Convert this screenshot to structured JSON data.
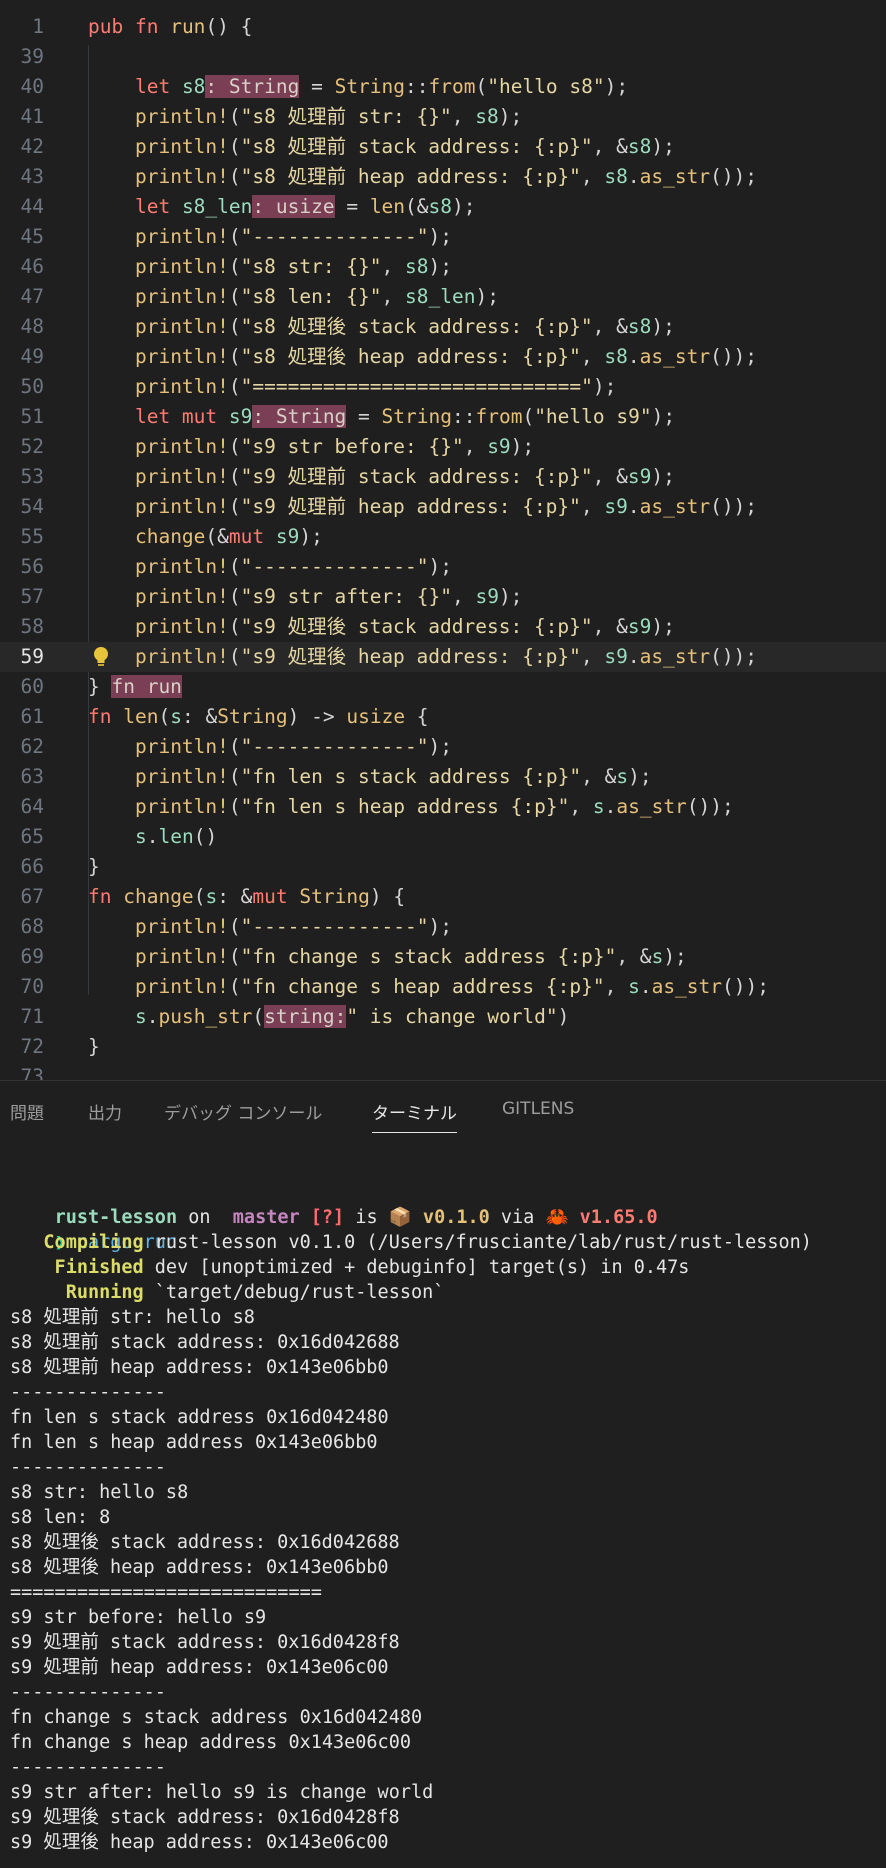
{
  "editor": {
    "active_line": "59",
    "lines": [
      {
        "n": "1",
        "tokens": [
          [
            "kw",
            "pub "
          ],
          [
            "kw",
            "fn "
          ],
          [
            "fnn",
            "run"
          ],
          [
            "punc",
            "() {"
          ]
        ]
      },
      {
        "n": "39",
        "tokens": []
      },
      {
        "n": "40",
        "tokens": [
          [
            "plain",
            "    "
          ],
          [
            "kw",
            "let "
          ],
          [
            "var",
            "s8"
          ],
          [
            "hint",
            ": String"
          ],
          [
            "punc",
            " = "
          ],
          [
            "fnn",
            "String"
          ],
          [
            "punc",
            "::"
          ],
          [
            "fnn",
            "from"
          ],
          [
            "punc",
            "("
          ],
          [
            "str",
            "\"hello s8\""
          ],
          [
            "punc",
            ");"
          ]
        ]
      },
      {
        "n": "41",
        "tokens": [
          [
            "plain",
            "    "
          ],
          [
            "mac",
            "println!"
          ],
          [
            "punc",
            "("
          ],
          [
            "str",
            "\"s8 処理前 str: {}\""
          ],
          [
            "punc",
            ", "
          ],
          [
            "var",
            "s8"
          ],
          [
            "punc",
            ");"
          ]
        ]
      },
      {
        "n": "42",
        "tokens": [
          [
            "plain",
            "    "
          ],
          [
            "mac",
            "println!"
          ],
          [
            "punc",
            "("
          ],
          [
            "str",
            "\"s8 処理前 stack address: {:p}\""
          ],
          [
            "punc",
            ", &"
          ],
          [
            "var",
            "s8"
          ],
          [
            "punc",
            ");"
          ]
        ]
      },
      {
        "n": "43",
        "tokens": [
          [
            "plain",
            "    "
          ],
          [
            "mac",
            "println!"
          ],
          [
            "punc",
            "("
          ],
          [
            "str",
            "\"s8 処理前 heap address: {:p}\""
          ],
          [
            "punc",
            ", "
          ],
          [
            "var",
            "s8"
          ],
          [
            "punc",
            "."
          ],
          [
            "fnn",
            "as_str"
          ],
          [
            "punc",
            "());"
          ]
        ]
      },
      {
        "n": "44",
        "tokens": [
          [
            "plain",
            "    "
          ],
          [
            "kw",
            "let "
          ],
          [
            "var",
            "s8_len"
          ],
          [
            "hint",
            ": usize"
          ],
          [
            "punc",
            " = "
          ],
          [
            "fnn",
            "len"
          ],
          [
            "punc",
            "(&"
          ],
          [
            "var",
            "s8"
          ],
          [
            "punc",
            ");"
          ]
        ]
      },
      {
        "n": "45",
        "tokens": [
          [
            "plain",
            "    "
          ],
          [
            "mac",
            "println!"
          ],
          [
            "punc",
            "("
          ],
          [
            "str",
            "\"--------------\""
          ],
          [
            "punc",
            ");"
          ]
        ]
      },
      {
        "n": "46",
        "tokens": [
          [
            "plain",
            "    "
          ],
          [
            "mac",
            "println!"
          ],
          [
            "punc",
            "("
          ],
          [
            "str",
            "\"s8 str: {}\""
          ],
          [
            "punc",
            ", "
          ],
          [
            "var",
            "s8"
          ],
          [
            "punc",
            ");"
          ]
        ]
      },
      {
        "n": "47",
        "tokens": [
          [
            "plain",
            "    "
          ],
          [
            "mac",
            "println!"
          ],
          [
            "punc",
            "("
          ],
          [
            "str",
            "\"s8 len: {}\""
          ],
          [
            "punc",
            ", "
          ],
          [
            "var",
            "s8_len"
          ],
          [
            "punc",
            ");"
          ]
        ]
      },
      {
        "n": "48",
        "tokens": [
          [
            "plain",
            "    "
          ],
          [
            "mac",
            "println!"
          ],
          [
            "punc",
            "("
          ],
          [
            "str",
            "\"s8 処理後 stack address: {:p}\""
          ],
          [
            "punc",
            ", &"
          ],
          [
            "var",
            "s8"
          ],
          [
            "punc",
            ");"
          ]
        ]
      },
      {
        "n": "49",
        "tokens": [
          [
            "plain",
            "    "
          ],
          [
            "mac",
            "println!"
          ],
          [
            "punc",
            "("
          ],
          [
            "str",
            "\"s8 処理後 heap address: {:p}\""
          ],
          [
            "punc",
            ", "
          ],
          [
            "var",
            "s8"
          ],
          [
            "punc",
            "."
          ],
          [
            "fnn",
            "as_str"
          ],
          [
            "punc",
            "());"
          ]
        ]
      },
      {
        "n": "50",
        "tokens": [
          [
            "plain",
            "    "
          ],
          [
            "mac",
            "println!"
          ],
          [
            "punc",
            "("
          ],
          [
            "str",
            "\"============================\""
          ],
          [
            "punc",
            ");"
          ]
        ]
      },
      {
        "n": "51",
        "tokens": [
          [
            "plain",
            "    "
          ],
          [
            "kw",
            "let mut "
          ],
          [
            "var",
            "s9"
          ],
          [
            "hint",
            ": String"
          ],
          [
            "punc",
            " = "
          ],
          [
            "fnn",
            "String"
          ],
          [
            "punc",
            "::"
          ],
          [
            "fnn",
            "from"
          ],
          [
            "punc",
            "("
          ],
          [
            "str",
            "\"hello s9\""
          ],
          [
            "punc",
            ");"
          ]
        ]
      },
      {
        "n": "52",
        "tokens": [
          [
            "plain",
            "    "
          ],
          [
            "mac",
            "println!"
          ],
          [
            "punc",
            "("
          ],
          [
            "str",
            "\"s9 str before: {}\""
          ],
          [
            "punc",
            ", "
          ],
          [
            "var",
            "s9"
          ],
          [
            "punc",
            ");"
          ]
        ]
      },
      {
        "n": "53",
        "tokens": [
          [
            "plain",
            "    "
          ],
          [
            "mac",
            "println!"
          ],
          [
            "punc",
            "("
          ],
          [
            "str",
            "\"s9 処理前 stack address: {:p}\""
          ],
          [
            "punc",
            ", &"
          ],
          [
            "var",
            "s9"
          ],
          [
            "punc",
            ");"
          ]
        ]
      },
      {
        "n": "54",
        "tokens": [
          [
            "plain",
            "    "
          ],
          [
            "mac",
            "println!"
          ],
          [
            "punc",
            "("
          ],
          [
            "str",
            "\"s9 処理前 heap address: {:p}\""
          ],
          [
            "punc",
            ", "
          ],
          [
            "var",
            "s9"
          ],
          [
            "punc",
            "."
          ],
          [
            "fnn",
            "as_str"
          ],
          [
            "punc",
            "());"
          ]
        ]
      },
      {
        "n": "55",
        "tokens": [
          [
            "plain",
            "    "
          ],
          [
            "fnn",
            "change"
          ],
          [
            "punc",
            "(&"
          ],
          [
            "kw",
            "mut "
          ],
          [
            "var",
            "s9"
          ],
          [
            "punc",
            ");"
          ]
        ]
      },
      {
        "n": "56",
        "tokens": [
          [
            "plain",
            "    "
          ],
          [
            "mac",
            "println!"
          ],
          [
            "punc",
            "("
          ],
          [
            "str",
            "\"--------------\""
          ],
          [
            "punc",
            ");"
          ]
        ]
      },
      {
        "n": "57",
        "tokens": [
          [
            "plain",
            "    "
          ],
          [
            "mac",
            "println!"
          ],
          [
            "punc",
            "("
          ],
          [
            "str",
            "\"s9 str after: {}\""
          ],
          [
            "punc",
            ", "
          ],
          [
            "var",
            "s9"
          ],
          [
            "punc",
            ");"
          ]
        ]
      },
      {
        "n": "58",
        "tokens": [
          [
            "plain",
            "    "
          ],
          [
            "mac",
            "println!"
          ],
          [
            "punc",
            "("
          ],
          [
            "str",
            "\"s9 処理後 stack address: {:p}\""
          ],
          [
            "punc",
            ", &"
          ],
          [
            "var",
            "s9"
          ],
          [
            "punc",
            ");"
          ]
        ]
      },
      {
        "n": "59",
        "tokens": [
          [
            "plain",
            "    "
          ],
          [
            "mac",
            "println!"
          ],
          [
            "punc",
            "("
          ],
          [
            "str",
            "\"s9 処理後 heap address: {:p}\""
          ],
          [
            "punc",
            ", "
          ],
          [
            "var",
            "s9"
          ],
          [
            "punc",
            "."
          ],
          [
            "fnn",
            "as_str"
          ],
          [
            "punc",
            "());"
          ]
        ]
      },
      {
        "n": "60",
        "tokens": [
          [
            "punc",
            "} "
          ],
          [
            "hint",
            "fn run"
          ]
        ]
      },
      {
        "n": "61",
        "tokens": [
          [
            "kw",
            "fn "
          ],
          [
            "fnn",
            "len"
          ],
          [
            "punc",
            "("
          ],
          [
            "var",
            "s"
          ],
          [
            "punc",
            ": &"
          ],
          [
            "fnn",
            "String"
          ],
          [
            "punc",
            ") -> "
          ],
          [
            "fnn",
            "usize"
          ],
          [
            "punc",
            " {"
          ]
        ]
      },
      {
        "n": "62",
        "tokens": [
          [
            "plain",
            "    "
          ],
          [
            "mac",
            "println!"
          ],
          [
            "punc",
            "("
          ],
          [
            "str",
            "\"--------------\""
          ],
          [
            "punc",
            ");"
          ]
        ]
      },
      {
        "n": "63",
        "tokens": [
          [
            "plain",
            "    "
          ],
          [
            "mac",
            "println!"
          ],
          [
            "punc",
            "("
          ],
          [
            "str",
            "\"fn len s stack address {:p}\""
          ],
          [
            "punc",
            ", &"
          ],
          [
            "var",
            "s"
          ],
          [
            "punc",
            ");"
          ]
        ]
      },
      {
        "n": "64",
        "tokens": [
          [
            "plain",
            "    "
          ],
          [
            "mac",
            "println!"
          ],
          [
            "punc",
            "("
          ],
          [
            "str",
            "\"fn len s heap address {:p}\""
          ],
          [
            "punc",
            ", "
          ],
          [
            "var",
            "s"
          ],
          [
            "punc",
            "."
          ],
          [
            "fnn",
            "as_str"
          ],
          [
            "punc",
            "());"
          ]
        ]
      },
      {
        "n": "65",
        "tokens": [
          [
            "plain",
            "    "
          ],
          [
            "var",
            "s"
          ],
          [
            "punc",
            "."
          ],
          [
            "var",
            "len"
          ],
          [
            "punc",
            "()"
          ]
        ]
      },
      {
        "n": "66",
        "tokens": [
          [
            "punc",
            "}"
          ]
        ]
      },
      {
        "n": "67",
        "tokens": [
          [
            "kw",
            "fn "
          ],
          [
            "fnn",
            "change"
          ],
          [
            "punc",
            "("
          ],
          [
            "var",
            "s"
          ],
          [
            "punc",
            ": &"
          ],
          [
            "kw",
            "mut "
          ],
          [
            "fnn",
            "String"
          ],
          [
            "punc",
            ") {"
          ]
        ]
      },
      {
        "n": "68",
        "tokens": [
          [
            "plain",
            "    "
          ],
          [
            "mac",
            "println!"
          ],
          [
            "punc",
            "("
          ],
          [
            "str",
            "\"--------------\""
          ],
          [
            "punc",
            ");"
          ]
        ]
      },
      {
        "n": "69",
        "tokens": [
          [
            "plain",
            "    "
          ],
          [
            "mac",
            "println!"
          ],
          [
            "punc",
            "("
          ],
          [
            "str",
            "\"fn change s stack address {:p}\""
          ],
          [
            "punc",
            ", &"
          ],
          [
            "var",
            "s"
          ],
          [
            "punc",
            ");"
          ]
        ]
      },
      {
        "n": "70",
        "tokens": [
          [
            "plain",
            "    "
          ],
          [
            "mac",
            "println!"
          ],
          [
            "punc",
            "("
          ],
          [
            "str",
            "\"fn change s heap address {:p}\""
          ],
          [
            "punc",
            ", "
          ],
          [
            "var",
            "s"
          ],
          [
            "punc",
            "."
          ],
          [
            "fnn",
            "as_str"
          ],
          [
            "punc",
            "());"
          ]
        ]
      },
      {
        "n": "71",
        "tokens": [
          [
            "plain",
            "    "
          ],
          [
            "var",
            "s"
          ],
          [
            "punc",
            "."
          ],
          [
            "fnn",
            "push_str"
          ],
          [
            "punc",
            "("
          ],
          [
            "hint",
            "string:"
          ],
          [
            "str",
            "\" is change world\""
          ],
          [
            "punc",
            ")"
          ]
        ]
      },
      {
        "n": "72",
        "tokens": [
          [
            "punc",
            "}"
          ]
        ]
      },
      {
        "n": "73",
        "tokens": []
      }
    ]
  },
  "panel": {
    "tabs": [
      "問題",
      "出力",
      "デバッグ コンソール",
      "ターミナル",
      "GITLENS"
    ],
    "active_tab": "ターミナル"
  },
  "terminal": {
    "prompt": {
      "dir": "rust-lesson",
      "on": " on ",
      "branch_icon": "",
      "branch": " master",
      "status": " [?]",
      "is": " is ",
      "pkg_icon": "📦",
      "version": " v0.1.0",
      "via": " via ",
      "rust_icon": "🦀",
      "rust_version": " v1.65.0"
    },
    "command_arrow": "❯",
    "command": " cargo run",
    "build_lines": [
      {
        "label": "   Compiling",
        "text": " rust-lesson v0.1.0 (/Users/frusciante/lab/rust/rust-lesson)"
      },
      {
        "label": "    Finished",
        "text": " dev [unoptimized + debuginfo] target(s) in 0.47s"
      },
      {
        "label": "     Running",
        "text": " `target/debug/rust-lesson`"
      }
    ],
    "output": [
      "s8 処理前 str: hello s8",
      "s8 処理前 stack address: 0x16d042688",
      "s8 処理前 heap address: 0x143e06bb0",
      "--------------",
      "fn len s stack address 0x16d042480",
      "fn len s heap address 0x143e06bb0",
      "--------------",
      "s8 str: hello s8",
      "s8 len: 8",
      "s8 処理後 stack address: 0x16d042688",
      "s8 処理後 heap address: 0x143e06bb0",
      "============================",
      "s9 str before: hello s9",
      "s9 処理前 stack address: 0x16d0428f8",
      "s9 処理前 heap address: 0x143e06c00",
      "--------------",
      "fn change s stack address 0x16d042480",
      "fn change s heap address 0x143e06c00",
      "--------------",
      "s9 str after: hello s9 is change world",
      "s9 処理後 stack address: 0x16d0428f8",
      "s9 処理後 heap address: 0x143e06c00"
    ]
  }
}
